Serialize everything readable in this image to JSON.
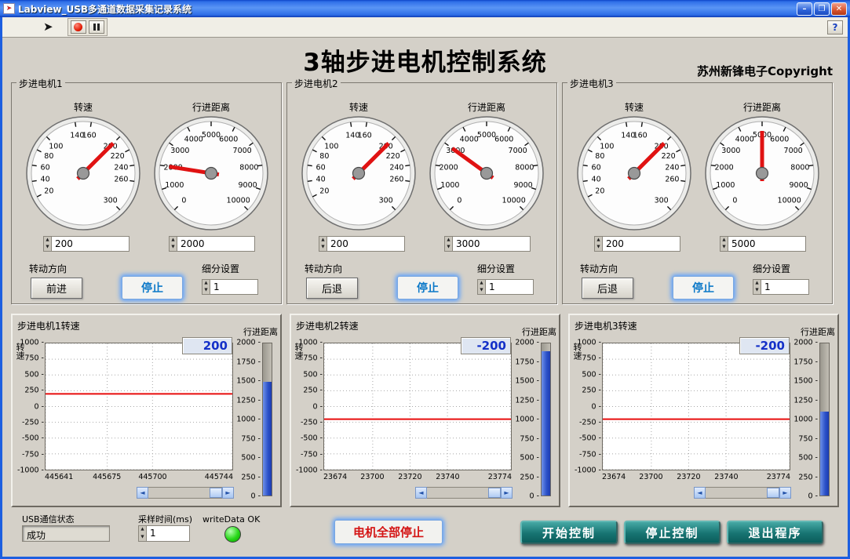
{
  "window": {
    "title": "Labview_USB多通道数据采集记录系统",
    "minimize_label": "–",
    "maximize_label": "❐",
    "close_label": "✕"
  },
  "toolbar": {
    "help_label": "?"
  },
  "header": {
    "title": "3轴步进电机控制系统",
    "copyright": "苏州新锋电子Copyright"
  },
  "motors": [
    {
      "panel_label": "步进电机1",
      "speed_gauge": {
        "label": "转速",
        "min": 0,
        "max": 300,
        "tick_labels": [
          20,
          40,
          60,
          80,
          100,
          140,
          160,
          200,
          220,
          240,
          260,
          300
        ],
        "value": 200,
        "input": "200"
      },
      "distance_gauge": {
        "label": "行进距离",
        "min": 0,
        "max": 10000,
        "tick_labels": [
          0,
          1000,
          2000,
          3000,
          4000,
          5000,
          6000,
          7000,
          8000,
          9000,
          10000
        ],
        "value": 2000,
        "input": "2000"
      },
      "direction_label": "转动方向",
      "direction_button": "前进",
      "stop_button": "停止",
      "subdivision_label": "细分设置",
      "subdivision_value": "1"
    },
    {
      "panel_label": "步进电机2",
      "speed_gauge": {
        "label": "转速",
        "min": 0,
        "max": 300,
        "tick_labels": [
          20,
          40,
          60,
          80,
          100,
          140,
          160,
          200,
          220,
          240,
          260,
          300
        ],
        "value": 200,
        "input": "200"
      },
      "distance_gauge": {
        "label": "行进距离",
        "min": 0,
        "max": 10000,
        "tick_labels": [
          0,
          1000,
          2000,
          3000,
          4000,
          5000,
          6000,
          7000,
          8000,
          9000,
          10000
        ],
        "value": 3000,
        "input": "3000"
      },
      "direction_label": "转动方向",
      "direction_button": "后退",
      "stop_button": "停止",
      "subdivision_label": "细分设置",
      "subdivision_value": "1"
    },
    {
      "panel_label": "步进电机3",
      "speed_gauge": {
        "label": "转速",
        "min": 0,
        "max": 300,
        "tick_labels": [
          20,
          40,
          60,
          80,
          100,
          140,
          160,
          200,
          220,
          240,
          260,
          300
        ],
        "value": 200,
        "input": "200"
      },
      "distance_gauge": {
        "label": "行进距离",
        "min": 0,
        "max": 10000,
        "tick_labels": [
          0,
          1000,
          2000,
          3000,
          4000,
          5000,
          6000,
          7000,
          8000,
          9000,
          10000
        ],
        "value": 5000,
        "input": "5000"
      },
      "direction_label": "转动方向",
      "direction_button": "后退",
      "stop_button": "停止",
      "subdivision_label": "细分设置",
      "subdivision_value": "1"
    }
  ],
  "charts": [
    {
      "type": "line",
      "title": "步进电机1转速",
      "digital_value": "200",
      "y_label": "转速",
      "y_min": -1000,
      "y_max": 1000,
      "y_ticks": [
        1000,
        750,
        500,
        250,
        0,
        -250,
        -500,
        -750,
        -1000
      ],
      "x_ticks": [
        445641,
        445675,
        445700,
        445744
      ],
      "line_value": 200,
      "line_color": "#ff0000",
      "bar_label": "行进距离",
      "bar_max": 2000,
      "bar_ticks": [
        2000,
        1750,
        1500,
        1250,
        1000,
        750,
        500,
        250,
        0
      ],
      "bar_value": 1500
    },
    {
      "type": "line",
      "title": "步进电机2转速",
      "digital_value": "-200",
      "y_label": "转速",
      "y_min": -1000,
      "y_max": 1000,
      "y_ticks": [
        1000,
        750,
        500,
        250,
        0,
        -250,
        -500,
        -750,
        -1000
      ],
      "x_ticks": [
        23674,
        23700,
        23720,
        23740,
        23774
      ],
      "line_value": -200,
      "line_color": "#ff0000",
      "bar_label": "行进距离",
      "bar_max": 2000,
      "bar_ticks": [
        2000,
        1750,
        1500,
        1250,
        1000,
        750,
        500,
        250,
        0
      ],
      "bar_value": 1900
    },
    {
      "type": "line",
      "title": "步进电机3转速",
      "digital_value": "-200",
      "y_label": "转速",
      "y_min": -1000,
      "y_max": 1000,
      "y_ticks": [
        1000,
        750,
        500,
        250,
        0,
        -250,
        -500,
        -750,
        -1000
      ],
      "x_ticks": [
        23674,
        23700,
        23720,
        23740,
        23774
      ],
      "line_value": -200,
      "line_color": "#ff0000",
      "bar_label": "行进距离",
      "bar_max": 2000,
      "bar_ticks": [
        2000,
        1750,
        1500,
        1250,
        1000,
        750,
        500,
        250,
        0
      ],
      "bar_value": 1100
    }
  ],
  "footer": {
    "usb_status_label": "USB通信状态",
    "usb_status_value": "成功",
    "sample_time_label": "采样时间(ms)",
    "sample_time_value": "1",
    "write_data_label": "writeData OK",
    "stop_all_button": "电机全部停止",
    "start_button": "开始控制",
    "stop_control_button": "停止控制",
    "exit_button": "退出程序"
  }
}
